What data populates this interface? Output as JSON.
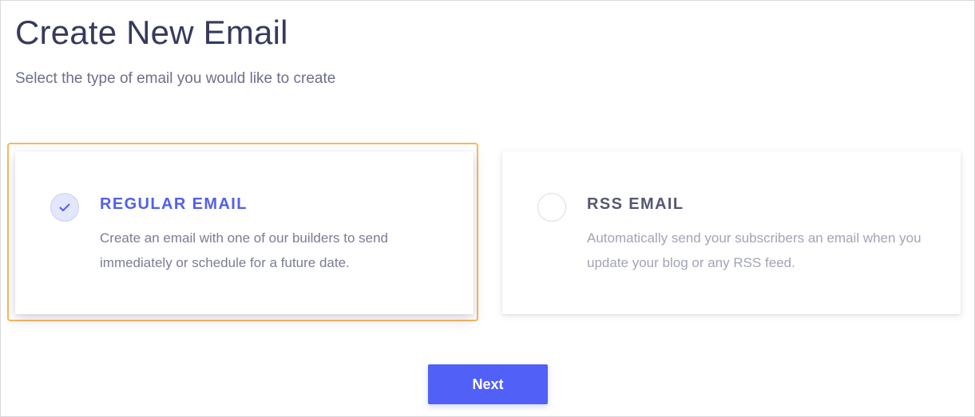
{
  "page": {
    "title": "Create New Email",
    "subtitle": "Select the type of email you would like to create"
  },
  "options": [
    {
      "title": "REGULAR EMAIL",
      "description": "Create an email with one of our builders to send immediately or schedule for a future date.",
      "selected": true,
      "icon": "check-icon"
    },
    {
      "title": "RSS EMAIL",
      "description": "Automatically send your subscribers an email when you update your blog or any RSS feed.",
      "selected": false,
      "icon": ""
    }
  ],
  "actions": {
    "next_label": "Next"
  },
  "colors": {
    "accent": "#5160f7",
    "selected_title": "#5160ec",
    "selection_outline": "#f7b85c",
    "heading": "#363a5c"
  }
}
